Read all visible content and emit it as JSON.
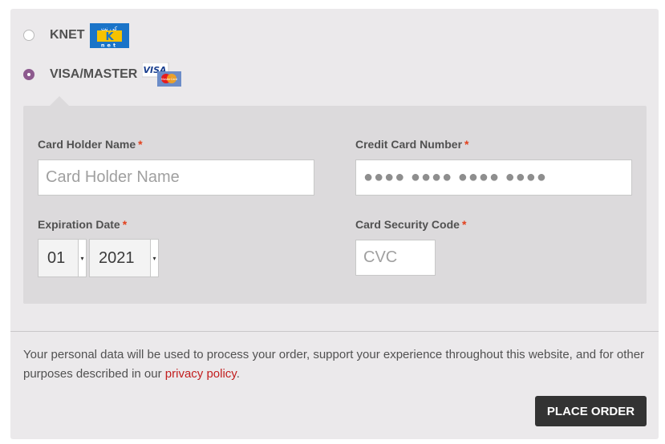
{
  "payment_methods": [
    {
      "label": "KNET",
      "selected": false,
      "logo_text": "k"
    },
    {
      "label": "VISA/MASTER",
      "selected": true,
      "logo_text": "VISA"
    }
  ],
  "card_form": {
    "holder_name_label": "Card Holder Name",
    "holder_name_placeholder": "Card Holder Name",
    "card_number_label": "Credit Card Number",
    "card_number_placeholder": "●●●● ●●●● ●●●● ●●●●",
    "expiration_label": "Expiration Date",
    "expiry_month": "01",
    "expiry_year": "2021",
    "cvc_label": "Card Security Code",
    "cvc_placeholder": "CVC",
    "required_mark": "*"
  },
  "privacy_notice": {
    "text": "Your personal data will be used to process your order, support your experience throughout this website, and for other purposes described in our ",
    "link_text": "privacy policy",
    "trailing": "."
  },
  "place_order_label": "PLACE ORDER",
  "colors": {
    "accent": "#8d5a8e",
    "required": "#e2401c",
    "link": "#c21e1e",
    "button_bg": "#333333"
  }
}
